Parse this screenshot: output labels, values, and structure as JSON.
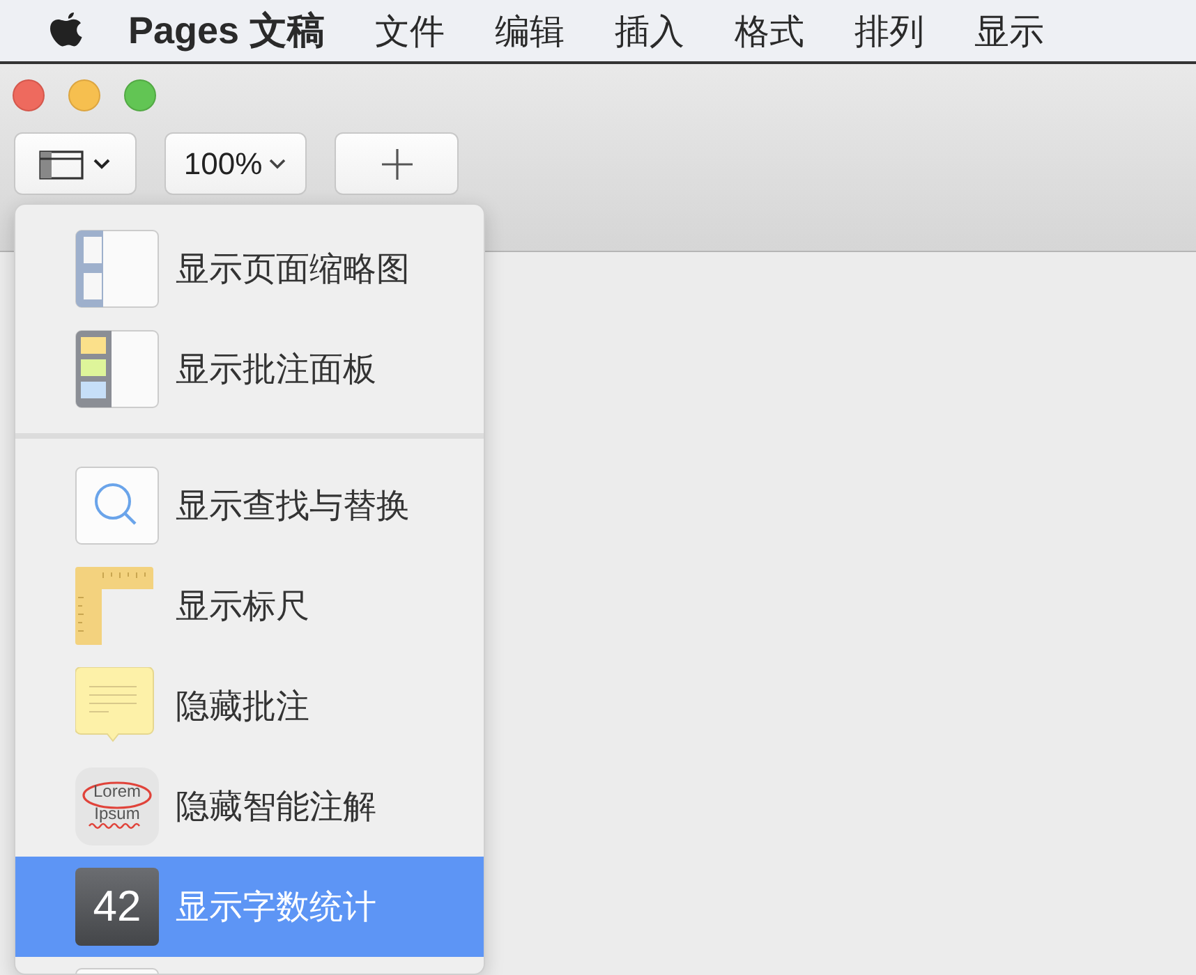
{
  "menu_bar": {
    "app_name": "Pages 文稿",
    "items": [
      "文件",
      "编辑",
      "插入",
      "格式",
      "排列",
      "显示"
    ]
  },
  "toolbar": {
    "zoom": "100%"
  },
  "view_menu": {
    "items": [
      {
        "kind": "thumbnails",
        "label": "显示页面缩略图",
        "selected": false
      },
      {
        "kind": "comments",
        "label": "显示批注面板",
        "selected": false
      },
      {
        "kind": "separator"
      },
      {
        "kind": "search",
        "label": "显示查找与替换",
        "selected": false
      },
      {
        "kind": "ruler",
        "label": "显示标尺",
        "selected": false
      },
      {
        "kind": "note",
        "label": "隐藏批注",
        "selected": false
      },
      {
        "kind": "smart",
        "label": "隐藏智能注解",
        "icon_text": [
          "Lorem",
          "Ipsum"
        ],
        "selected": false
      },
      {
        "kind": "count",
        "label": "显示字数统计",
        "icon_text": [
          "42"
        ],
        "selected": true
      },
      {
        "kind": "blank",
        "selected": false
      }
    ]
  }
}
